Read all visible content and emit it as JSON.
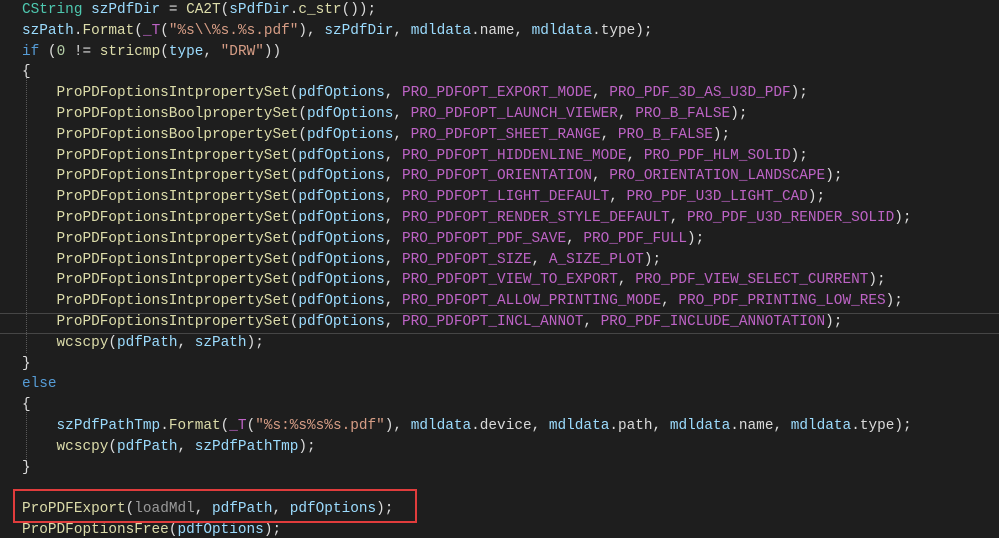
{
  "window": {
    "title": ""
  },
  "colors": {
    "background": "#1e1e1e",
    "type": "#4ec9b0",
    "function": "#dcdcaa",
    "variable": "#9cdcfe",
    "macro": "#bd63c5",
    "keyword": "#569cd6",
    "string": "#d69d85",
    "number": "#b5cea8",
    "punctuation": "#dcdcdc",
    "highlight_box": "#e03c3c"
  },
  "code": {
    "lines": [
      [
        [
          "type",
          "CString"
        ],
        [
          "plain",
          " "
        ],
        [
          "var",
          "szPdfDir"
        ],
        [
          "plain",
          " = "
        ],
        [
          "func",
          "CA2T"
        ],
        [
          "plain",
          "("
        ],
        [
          "var",
          "sPdfDir"
        ],
        [
          "plain",
          "."
        ],
        [
          "func",
          "c_str"
        ],
        [
          "plain",
          "());"
        ]
      ],
      [
        [
          "var",
          "szPath"
        ],
        [
          "plain",
          "."
        ],
        [
          "func",
          "Format"
        ],
        [
          "plain",
          "("
        ],
        [
          "const",
          "_T"
        ],
        [
          "plain",
          "("
        ],
        [
          "str",
          "\"%s\\\\%s.%s.pdf\""
        ],
        [
          "plain",
          "), "
        ],
        [
          "var",
          "szPdfDir"
        ],
        [
          "plain",
          ", "
        ],
        [
          "var",
          "mdldata"
        ],
        [
          "plain",
          "."
        ],
        [
          "mem",
          "name"
        ],
        [
          "plain",
          ", "
        ],
        [
          "var",
          "mdldata"
        ],
        [
          "plain",
          "."
        ],
        [
          "mem",
          "type"
        ],
        [
          "plain",
          ");"
        ]
      ],
      [
        [
          "kw",
          "if"
        ],
        [
          "plain",
          " ("
        ],
        [
          "num",
          "0"
        ],
        [
          "plain",
          " != "
        ],
        [
          "func",
          "stricmp"
        ],
        [
          "plain",
          "("
        ],
        [
          "var",
          "type"
        ],
        [
          "plain",
          ", "
        ],
        [
          "str",
          "\"DRW\""
        ],
        [
          "plain",
          "))"
        ]
      ],
      [
        [
          "plain",
          "{"
        ]
      ],
      [
        [
          "plain",
          "    "
        ],
        [
          "func",
          "ProPDFoptionsIntpropertySet"
        ],
        [
          "plain",
          "("
        ],
        [
          "var",
          "pdfOptions"
        ],
        [
          "plain",
          ", "
        ],
        [
          "const",
          "PRO_PDFOPT_EXPORT_MODE"
        ],
        [
          "plain",
          ", "
        ],
        [
          "const",
          "PRO_PDF_3D_AS_U3D_PDF"
        ],
        [
          "plain",
          ");"
        ]
      ],
      [
        [
          "plain",
          "    "
        ],
        [
          "func",
          "ProPDFoptionsBoolpropertySet"
        ],
        [
          "plain",
          "("
        ],
        [
          "var",
          "pdfOptions"
        ],
        [
          "plain",
          ", "
        ],
        [
          "const",
          "PRO_PDFOPT_LAUNCH_VIEWER"
        ],
        [
          "plain",
          ", "
        ],
        [
          "const",
          "PRO_B_FALSE"
        ],
        [
          "plain",
          ");"
        ]
      ],
      [
        [
          "plain",
          "    "
        ],
        [
          "func",
          "ProPDFoptionsBoolpropertySet"
        ],
        [
          "plain",
          "("
        ],
        [
          "var",
          "pdfOptions"
        ],
        [
          "plain",
          ", "
        ],
        [
          "const",
          "PRO_PDFOPT_SHEET_RANGE"
        ],
        [
          "plain",
          ", "
        ],
        [
          "const",
          "PRO_B_FALSE"
        ],
        [
          "plain",
          ");"
        ]
      ],
      [
        [
          "plain",
          "    "
        ],
        [
          "func",
          "ProPDFoptionsIntpropertySet"
        ],
        [
          "plain",
          "("
        ],
        [
          "var",
          "pdfOptions"
        ],
        [
          "plain",
          ", "
        ],
        [
          "const",
          "PRO_PDFOPT_HIDDENLINE_MODE"
        ],
        [
          "plain",
          ", "
        ],
        [
          "const",
          "PRO_PDF_HLM_SOLID"
        ],
        [
          "plain",
          ");"
        ]
      ],
      [
        [
          "plain",
          "    "
        ],
        [
          "func",
          "ProPDFoptionsIntpropertySet"
        ],
        [
          "plain",
          "("
        ],
        [
          "var",
          "pdfOptions"
        ],
        [
          "plain",
          ", "
        ],
        [
          "const",
          "PRO_PDFOPT_ORIENTATION"
        ],
        [
          "plain",
          ", "
        ],
        [
          "const",
          "PRO_ORIENTATION_LANDSCAPE"
        ],
        [
          "plain",
          ");"
        ]
      ],
      [
        [
          "plain",
          "    "
        ],
        [
          "func",
          "ProPDFoptionsIntpropertySet"
        ],
        [
          "plain",
          "("
        ],
        [
          "var",
          "pdfOptions"
        ],
        [
          "plain",
          ", "
        ],
        [
          "const",
          "PRO_PDFOPT_LIGHT_DEFAULT"
        ],
        [
          "plain",
          ", "
        ],
        [
          "const",
          "PRO_PDF_U3D_LIGHT_CAD"
        ],
        [
          "plain",
          ");"
        ]
      ],
      [
        [
          "plain",
          "    "
        ],
        [
          "func",
          "ProPDFoptionsIntpropertySet"
        ],
        [
          "plain",
          "("
        ],
        [
          "var",
          "pdfOptions"
        ],
        [
          "plain",
          ", "
        ],
        [
          "const",
          "PRO_PDFOPT_RENDER_STYLE_DEFAULT"
        ],
        [
          "plain",
          ", "
        ],
        [
          "const",
          "PRO_PDF_U3D_RENDER_SOLID"
        ],
        [
          "plain",
          ");"
        ]
      ],
      [
        [
          "plain",
          "    "
        ],
        [
          "func",
          "ProPDFoptionsIntpropertySet"
        ],
        [
          "plain",
          "("
        ],
        [
          "var",
          "pdfOptions"
        ],
        [
          "plain",
          ", "
        ],
        [
          "const",
          "PRO_PDFOPT_PDF_SAVE"
        ],
        [
          "plain",
          ", "
        ],
        [
          "const",
          "PRO_PDF_FULL"
        ],
        [
          "plain",
          ");"
        ]
      ],
      [
        [
          "plain",
          "    "
        ],
        [
          "func",
          "ProPDFoptionsIntpropertySet"
        ],
        [
          "plain",
          "("
        ],
        [
          "var",
          "pdfOptions"
        ],
        [
          "plain",
          ", "
        ],
        [
          "const",
          "PRO_PDFOPT_SIZE"
        ],
        [
          "plain",
          ", "
        ],
        [
          "const",
          "A_SIZE_PLOT"
        ],
        [
          "plain",
          ");"
        ]
      ],
      [
        [
          "plain",
          "    "
        ],
        [
          "func",
          "ProPDFoptionsIntpropertySet"
        ],
        [
          "plain",
          "("
        ],
        [
          "var",
          "pdfOptions"
        ],
        [
          "plain",
          ", "
        ],
        [
          "const",
          "PRO_PDFOPT_VIEW_TO_EXPORT"
        ],
        [
          "plain",
          ", "
        ],
        [
          "const",
          "PRO_PDF_VIEW_SELECT_CURRENT"
        ],
        [
          "plain",
          ");"
        ]
      ],
      [
        [
          "plain",
          "    "
        ],
        [
          "func",
          "ProPDFoptionsIntpropertySet"
        ],
        [
          "plain",
          "("
        ],
        [
          "var",
          "pdfOptions"
        ],
        [
          "plain",
          ", "
        ],
        [
          "const",
          "PRO_PDFOPT_ALLOW_PRINTING_MODE"
        ],
        [
          "plain",
          ", "
        ],
        [
          "const",
          "PRO_PDF_PRINTING_LOW_RES"
        ],
        [
          "plain",
          ");"
        ]
      ],
      [
        [
          "plain",
          "    "
        ],
        [
          "func",
          "ProPDFoptionsIntpropertySet"
        ],
        [
          "plain",
          "("
        ],
        [
          "var",
          "pdfOptions"
        ],
        [
          "plain",
          ", "
        ],
        [
          "const",
          "PRO_PDFOPT_INCL_ANNOT"
        ],
        [
          "plain",
          ", "
        ],
        [
          "const",
          "PRO_PDF_INCLUDE_ANNOTATION"
        ],
        [
          "plain",
          ");"
        ]
      ],
      [
        [
          "plain",
          "    "
        ],
        [
          "func",
          "wcscpy"
        ],
        [
          "plain",
          "("
        ],
        [
          "var",
          "pdfPath"
        ],
        [
          "plain",
          ", "
        ],
        [
          "var",
          "szPath"
        ],
        [
          "plain",
          ");"
        ]
      ],
      [
        [
          "plain",
          "}"
        ]
      ],
      [
        [
          "kw",
          "else"
        ]
      ],
      [
        [
          "plain",
          "{"
        ]
      ],
      [
        [
          "plain",
          "    "
        ],
        [
          "var",
          "szPdfPathTmp"
        ],
        [
          "plain",
          "."
        ],
        [
          "func",
          "Format"
        ],
        [
          "plain",
          "("
        ],
        [
          "const",
          "_T"
        ],
        [
          "plain",
          "("
        ],
        [
          "str",
          "\"%s:%s%s%s.pdf\""
        ],
        [
          "plain",
          "), "
        ],
        [
          "var",
          "mdldata"
        ],
        [
          "plain",
          "."
        ],
        [
          "mem",
          "device"
        ],
        [
          "plain",
          ", "
        ],
        [
          "var",
          "mdldata"
        ],
        [
          "plain",
          "."
        ],
        [
          "mem",
          "path"
        ],
        [
          "plain",
          ", "
        ],
        [
          "var",
          "mdldata"
        ],
        [
          "plain",
          "."
        ],
        [
          "mem",
          "name"
        ],
        [
          "plain",
          ", "
        ],
        [
          "var",
          "mdldata"
        ],
        [
          "plain",
          "."
        ],
        [
          "mem",
          "type"
        ],
        [
          "plain",
          ");"
        ]
      ],
      [
        [
          "plain",
          "    "
        ],
        [
          "func",
          "wcscpy"
        ],
        [
          "plain",
          "("
        ],
        [
          "var",
          "pdfPath"
        ],
        [
          "plain",
          ", "
        ],
        [
          "var",
          "szPdfPathTmp"
        ],
        [
          "plain",
          ");"
        ]
      ],
      [
        [
          "plain",
          "}"
        ]
      ],
      [
        [
          "plain",
          ""
        ]
      ],
      [
        [
          "func",
          "ProPDFExport"
        ],
        [
          "plain",
          "("
        ],
        [
          "param",
          "loadMdl"
        ],
        [
          "plain",
          ", "
        ],
        [
          "var",
          "pdfPath"
        ],
        [
          "plain",
          ", "
        ],
        [
          "var",
          "pdfOptions"
        ],
        [
          "plain",
          ");"
        ]
      ],
      [
        [
          "func",
          "ProPDFoptionsFree"
        ],
        [
          "plain",
          "("
        ],
        [
          "var",
          "pdfOptions"
        ],
        [
          "plain",
          ");"
        ]
      ]
    ]
  }
}
